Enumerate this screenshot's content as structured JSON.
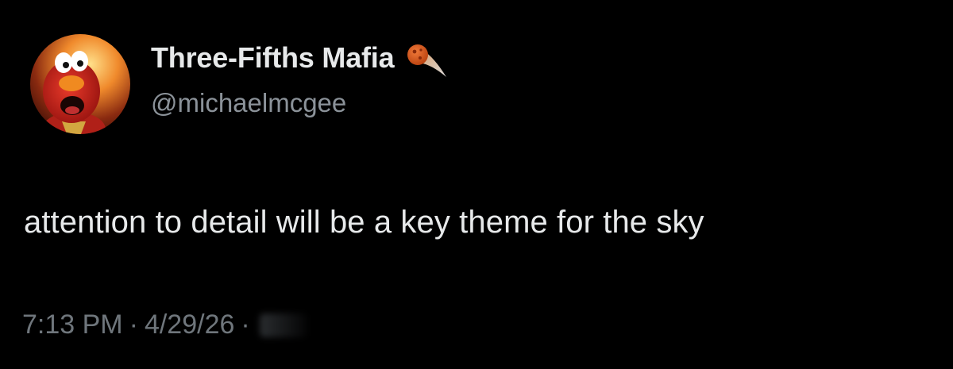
{
  "tweet": {
    "author": {
      "display_name": "Three-Fifths Mafia",
      "handle": "@michaelmcgee",
      "avatar_icon": "elmo-avatar-icon",
      "badge_icon": "meteor-emoji-icon"
    },
    "text": "attention to detail will be a key theme for the sky",
    "time": "7:13 PM",
    "date": "4/29/26",
    "separator": "·"
  },
  "colors": {
    "background": "#000000",
    "primary_text": "#e7e9ea",
    "secondary_text": "#8b9299",
    "meta_text": "#6f767c"
  }
}
